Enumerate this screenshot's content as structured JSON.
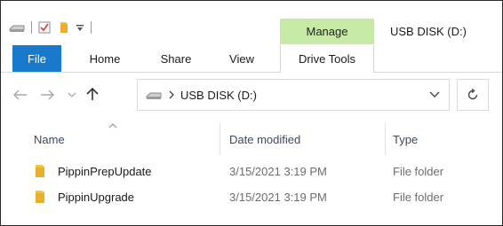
{
  "ribbon": {
    "contextual_tab": "Manage",
    "window_title": "USB DISK (D:)",
    "tabs": [
      {
        "label": "File"
      },
      {
        "label": "Home"
      },
      {
        "label": "Share"
      },
      {
        "label": "View"
      },
      {
        "label": "Drive Tools"
      }
    ]
  },
  "address_bar": {
    "path": "USB DISK (D:)",
    "dropdown_glyph": "⌄",
    "refresh_glyph": "↻"
  },
  "columns": {
    "name": "Name",
    "date_modified": "Date modified",
    "type": "Type"
  },
  "files": [
    {
      "name": "PippinPrepUpdate",
      "date_modified": "3/15/2021 3:19 PM",
      "type": "File folder"
    },
    {
      "name": "PippinUpgrade",
      "date_modified": "3/15/2021 3:19 PM",
      "type": "File folder"
    }
  ],
  "colors": {
    "file_tab": "#1979ca",
    "manage_tab": "#c7eaa6",
    "folder": "#f4c342"
  }
}
